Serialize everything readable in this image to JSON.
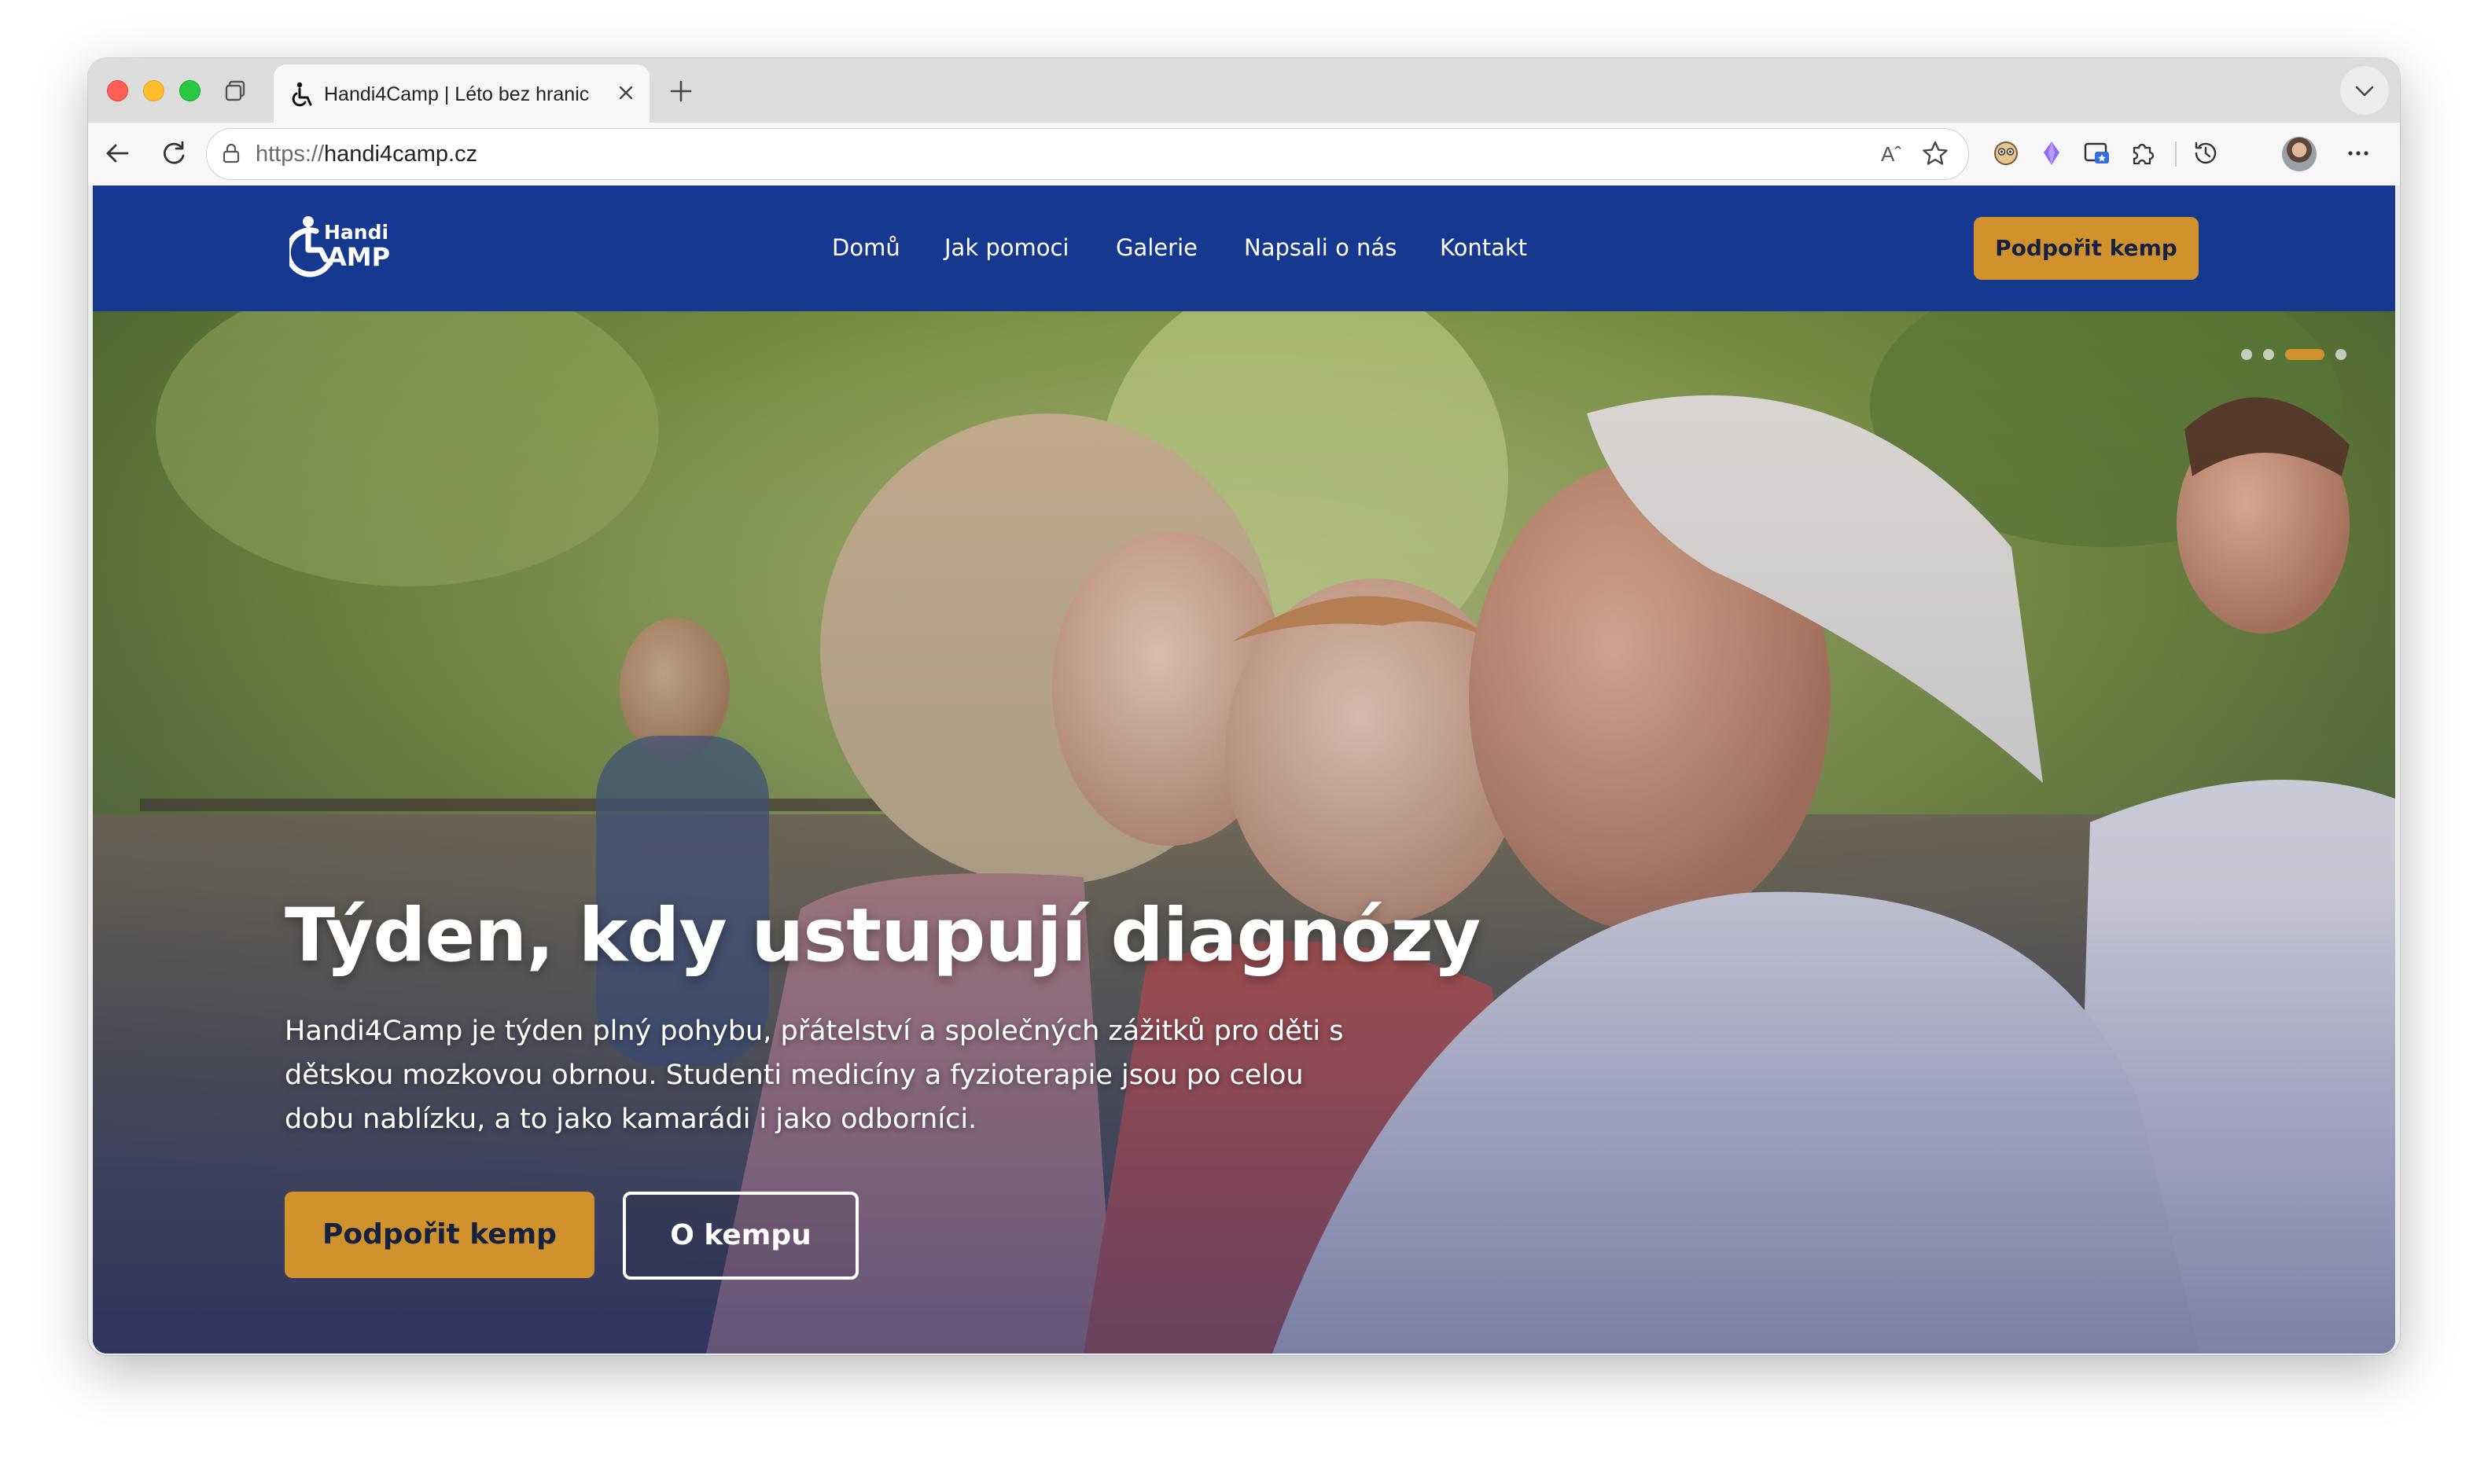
{
  "browser": {
    "tab_title": "Handi4Camp | Léto bez hranic",
    "url_protocol": "https://",
    "url_host": "handi4camp.cz",
    "read_aloud_label": "Aˆ"
  },
  "site": {
    "logo_line1": "Handi",
    "logo_line2": "AMP",
    "nav": [
      "Domů",
      "Jak pomoci",
      "Galerie",
      "Napsali o nás",
      "Kontakt"
    ],
    "nav_cta": "Podpořit kemp",
    "accent_color": "#d1922e",
    "brand_color": "#16398f"
  },
  "hero": {
    "title": "Týden, kdy ustupují diagnózy",
    "text": "Handi4Camp je týden plný pohybu, přátelství a společných zážitků pro děti s dětskou mozkovou obrnou. Studenti medicíny a fyzioterapie jsou po celou dobu nablízku, a to jako kamarádi i jako odborníci.",
    "primary_button": "Podpořit kemp",
    "secondary_button": "O kempu",
    "slide_count": 4,
    "active_slide": 3
  }
}
